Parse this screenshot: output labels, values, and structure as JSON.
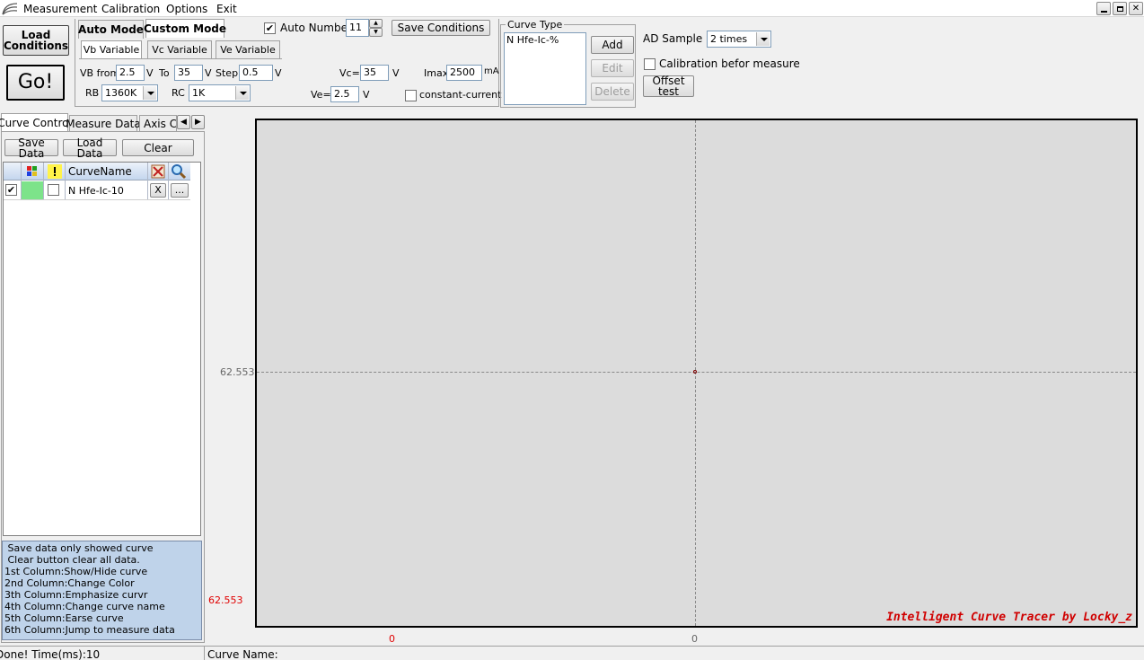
{
  "menu": {
    "items": [
      "Measurement",
      "Calibration",
      "Options",
      "Exit"
    ]
  },
  "left_buttons": {
    "load": "Load Conditions",
    "go": "Go!"
  },
  "mode_tabs": [
    "Auto Mode",
    "Custom Mode"
  ],
  "var_tabs": [
    "Vb Variable",
    "Vc Variable",
    "Ve Variable"
  ],
  "params": {
    "vb_from_label": "VB from",
    "vb_from": "2.5",
    "v": "V",
    "to_label": "To",
    "to": "35",
    "step_label": "Step",
    "step": "0.5",
    "rb_label": "RB",
    "rb": "1360K",
    "rc_label": "RC",
    "rc": "1K",
    "vc_label": "Vc=",
    "vc": "35",
    "ve_label": "Ve=",
    "ve": "2.5",
    "imax_label": "Imax",
    "imax": "2500",
    "ma": "mA",
    "constant_current": "constant-current"
  },
  "auto_number": {
    "label": "Auto Number",
    "value": "11"
  },
  "save_conditions": "Save Conditions",
  "curve_type": {
    "title": "Curve Type",
    "items": [
      "N Hfe-Ic-%"
    ],
    "add": "Add",
    "edit": "Edit",
    "delete": "Delete"
  },
  "ad_sample": {
    "label": "AD Sample",
    "value": "2 times"
  },
  "calibration_label": "Calibration befor measure",
  "offset_test": "Offset test",
  "side_tabs": [
    "Curve Control",
    "Measure Data",
    "Axis Co"
  ],
  "curve_buttons": {
    "save": "Save Data",
    "load": "Load Data",
    "clear": "Clear"
  },
  "table": {
    "header_name": "CurveName",
    "rows": [
      {
        "name": "N Hfe-Ic-10",
        "color": "#7de38a",
        "x": "X",
        "more": "..."
      }
    ]
  },
  "help_lines": [
    " Save data only showed curve",
    " Clear button clear all data.",
    "1st Column:Show/Hide curve",
    "2nd Column:Change Color",
    "3th Column:Emphasize curvr",
    "4th Column:Change curve name",
    "5th Column:Earse curve",
    "6th Column:Jump to measure data"
  ],
  "plot": {
    "y_mid": "62.553",
    "y_min": "62.553",
    "x_min": "0",
    "x_mid": "0",
    "watermark": "Intelligent Curve Tracer by Locky_z"
  },
  "status": {
    "left": "Done!  Time(ms):10",
    "right": "Curve Name:"
  },
  "colors": {
    "help_bg": "#bfd3ea",
    "plot_bg": "#dcdcdc",
    "axis_red": "#e00000",
    "watermark": "#d00000"
  }
}
